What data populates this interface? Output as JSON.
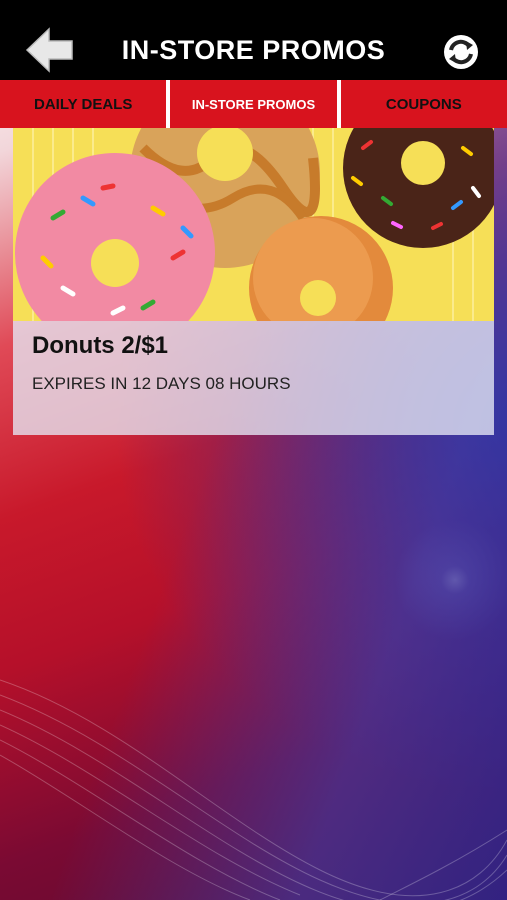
{
  "header": {
    "title": "IN-STORE PROMOS",
    "back_icon": "back-arrow-icon",
    "refresh_icon": "refresh-icon"
  },
  "tabs": [
    {
      "label": "DAILY DEALS",
      "active": false
    },
    {
      "label": "IN-STORE PROMOS",
      "active": true
    },
    {
      "label": "COUPONS",
      "active": false
    }
  ],
  "promos": [
    {
      "title": "Donuts 2/$1",
      "expiry": "EXPIRES IN 12 DAYS 08 HOURS"
    }
  ],
  "colors": {
    "header_bg": "#000000",
    "tab_bar": "#d8131e",
    "background_red": "#c8192b",
    "background_blue": "#2a2f9a"
  }
}
